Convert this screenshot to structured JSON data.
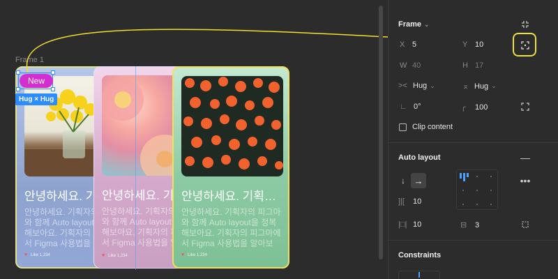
{
  "canvas": {
    "frame_label": "Frame 1",
    "new_badge": "New",
    "hug_badge": "Hug × Hug",
    "cards": [
      {
        "title": "안녕하세요. 기획자의 피그마",
        "body": "안녕하세요. 기획자의 피그마\n와 함께 Auto layout을 정복\n해보아요. 기획자의 피그마에\n서 Figma 사용법을 알아보",
        "like": "Like 1,234"
      },
      {
        "title": "안녕하세요. 기획자의 피그마",
        "body": "안녕하세요. 기획자의 피그마\n와 함께 Auto layout을 정복\n해보아요. 기획자의 피그마에\n서 Figma 사용법을 알아보",
        "like": "Like 1,234"
      },
      {
        "title": "안녕하세요. 기획자의 피그마",
        "body": "안녕하세요. 기획자의 피그마\n와 함께 Auto layout을 정복\n해보아요. 기획자의 피그마에\n서 Figma 사용법을 알아보",
        "like": "Like 1,234"
      }
    ]
  },
  "panel": {
    "frame": {
      "title": "Frame",
      "x_label": "X",
      "x_value": "5",
      "y_label": "Y",
      "y_value": "10",
      "w_label": "W",
      "w_value": "40",
      "h_label": "H",
      "h_value": "17",
      "width_mode": "Hug",
      "height_mode": "Hug",
      "rotation": "0°",
      "radius": "100",
      "clip_content": "Clip content"
    },
    "auto_layout": {
      "title": "Auto layout",
      "gap": "10",
      "padding_h": "10",
      "padding_v": "3"
    },
    "constraints": {
      "title": "Constraints"
    }
  },
  "colors": {
    "accent": "#2d8cff",
    "highlight": "#f3df2e",
    "badge": "#d32fd0"
  }
}
